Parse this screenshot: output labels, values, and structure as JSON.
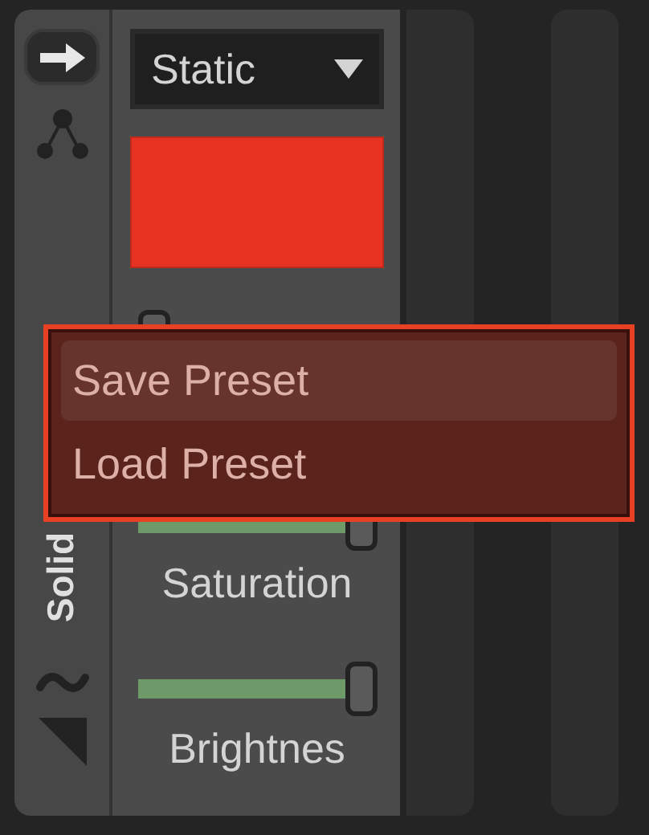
{
  "sidebar": {
    "mode_label": "Solid"
  },
  "dropdown": {
    "value": "Static"
  },
  "swatch": {
    "color": "#e83323"
  },
  "sliders": [
    {
      "level": 0
    },
    {
      "level": 1,
      "label": "Saturation"
    },
    {
      "level": 1,
      "label": "Brightnes"
    }
  ],
  "context_menu": {
    "items": [
      {
        "label": "Save Preset",
        "selected": true
      },
      {
        "label": "Load Preset",
        "selected": false
      }
    ]
  }
}
